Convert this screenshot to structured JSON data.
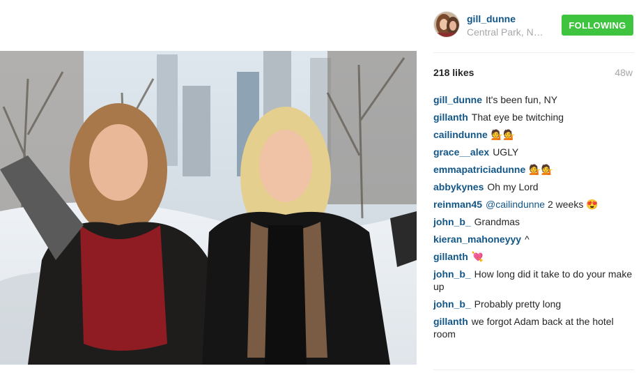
{
  "post": {
    "username": "gill_dunne",
    "location": "Central Park, New York",
    "follow_label": "FOLLOWING",
    "likes": "218 likes",
    "age": "48w"
  },
  "comments": [
    {
      "user": "gill_dunne",
      "text": "It's been fun, NY"
    },
    {
      "user": "gillanth",
      "text": "That eye be twitching"
    },
    {
      "user": "cailindunne",
      "text": "💁💁"
    },
    {
      "user": "grace__alex",
      "text": "UGLY"
    },
    {
      "user": "emmapatriciadunne",
      "text": "💁💁"
    },
    {
      "user": "abbykynes",
      "text": "Oh my Lord"
    },
    {
      "user": "reinman45",
      "mention": "@cailindunne",
      "text": "2 weeks 😍"
    },
    {
      "user": "john_b_",
      "text": "Grandmas"
    },
    {
      "user": "kieran_mahoneyyy",
      "text": "^"
    },
    {
      "user": "gillanth",
      "text": "💘"
    },
    {
      "user": "john_b_",
      "text": "How long did it take to do your make up"
    },
    {
      "user": "john_b_",
      "text": "Probably pretty long"
    },
    {
      "user": "gillanth",
      "text": "we forgot Adam back at the hotel room"
    }
  ]
}
